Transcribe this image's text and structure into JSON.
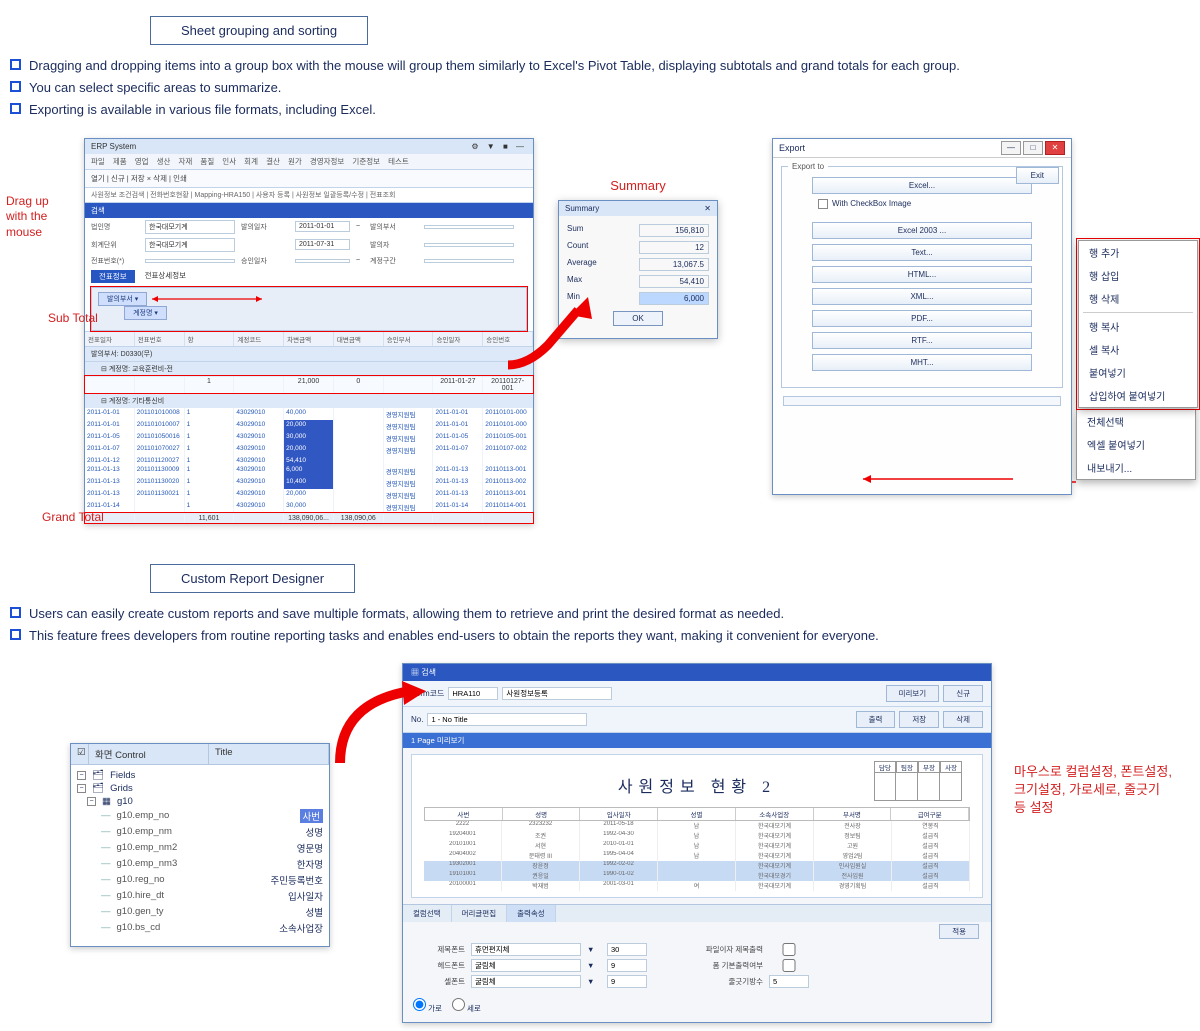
{
  "section1": {
    "title": "Sheet grouping and sorting",
    "bullets": [
      "Dragging and dropping items into a group box with the mouse will group them similarly to Excel's Pivot Table, displaying subtotals and grand totals for each group.",
      "You can select specific areas to summarize.",
      "Exporting is available in various file formats, including Excel."
    ],
    "annotations": {
      "drag": "Drag up\nwith the\nmouse",
      "subtotal": "Sub Total",
      "grandtotal": "Grand Total",
      "summary": "Summary"
    }
  },
  "erp": {
    "title": "ERP System",
    "menu": "파일 제품 영업 생산 자재 품질 인사 회계 결산 원가 경영자정보 기준정보 테스트",
    "toolbar": "열기 | 신규 | 저장 × 삭제 | 인쇄",
    "tabs": "사원정보 조건검색 | 전화번호현황 | Mapping-HRA150 | 사용자 등록 | 사원정보 일괄등록/수정 | 전표조회",
    "filters": {
      "r1l": "법인명",
      "r1v": "한국대모기계",
      "r1l2": "발의일자",
      "d1": "2011-01-01",
      "r1l3": "발의부서",
      "r2l": "회계단위",
      "r2v": "한국대모기계",
      "d2": "2011-07-31",
      "r2l3": "발의자",
      "r3l": "전표번호(*)",
      "r3l2": "승인일자",
      "r3l3": "계정구간"
    },
    "tab2l": "전표정보",
    "tab2r": "전표상세정보",
    "chip1": "발의부서 ▾",
    "chip2": "계정명 ▾",
    "gridHeaders": [
      "전표일자",
      "전표번호",
      "항",
      "계정코드",
      "차변금액",
      "대변금액",
      "승인부서",
      "승인일자",
      "승인번호"
    ],
    "group1": "발의부서: D0330(무)",
    "group2": "계정명: 교육훈련비-전",
    "subtotals": [
      "",
      "",
      "1",
      "",
      "21,000",
      "0",
      "",
      "",
      ""
    ],
    "group3": "계정명: 기타통신비",
    "rows": [
      [
        "2011-01-01",
        "201101010008",
        "1",
        "43029010",
        "40,000",
        "",
        "경영지원팀",
        "2011-01-01",
        "20110101-000"
      ],
      [
        "2011-01-01",
        "201101010007",
        "1",
        "43029010",
        "20,000",
        "",
        "경영지원팀",
        "2011-01-01",
        "20110101-000"
      ],
      [
        "2011-01-05",
        "201101050016",
        "1",
        "43029010",
        "30,000",
        "",
        "경영지원팀",
        "2011-01-05",
        "20110105-001"
      ],
      [
        "2011-01-07",
        "201101070027",
        "1",
        "43029010",
        "20,000",
        "",
        "경영지원팀",
        "2011-01-07",
        "20110107-002"
      ],
      [
        "2011-01-12",
        "201101120027",
        "1",
        "43029010",
        "54,410",
        "",
        "",
        "",
        ""
      ],
      [
        "2011-01-13",
        "201101130009",
        "1",
        "43029010",
        "6,000",
        "",
        "경영지원팀",
        "2011-01-13",
        "20110113-001"
      ],
      [
        "2011-01-13",
        "201101130020",
        "1",
        "43029010",
        "10,400",
        "",
        "경영지원팀",
        "2011-01-13",
        "20110113-002"
      ],
      [
        "2011-01-13",
        "201101130021",
        "1",
        "43029010",
        "20,000",
        "",
        "경영지원팀",
        "2011-01-13",
        "20110113-001"
      ],
      [
        "2011-01-14",
        "",
        "1",
        "43029010",
        "30,000",
        "",
        "경영지원팀",
        "2011-01-14",
        "20110114-001"
      ]
    ],
    "gt": [
      "",
      "",
      "11,601",
      "",
      "138,090,06...",
      "138,090,06",
      "",
      "",
      ""
    ],
    "extra_date": "2011-01-27",
    "extra_no": "20110127-001"
  },
  "summary": {
    "title": "Summary",
    "rows": [
      {
        "k": "Sum",
        "v": "156,810"
      },
      {
        "k": "Count",
        "v": "12"
      },
      {
        "k": "Average",
        "v": "13,067.5"
      },
      {
        "k": "Max",
        "v": "54,410"
      },
      {
        "k": "Min",
        "v": "6,000"
      }
    ],
    "ok": "OK"
  },
  "export": {
    "title": "Export",
    "group": "Export to",
    "exit": "Exit",
    "checkbox": "With CheckBox Image",
    "buttons": [
      "Excel...",
      "Excel 2003 ...",
      "Text...",
      "HTML...",
      "XML...",
      "PDF...",
      "RTF...",
      "MHT..."
    ]
  },
  "ctx": {
    "group1": [
      "행 추가",
      "행 삽입",
      "행 삭제"
    ],
    "group2": [
      "행 복사",
      "셀 복사",
      "붙여넣기",
      "삽입하여 붙여넣기"
    ],
    "group3": [
      "전체선택",
      "엑셀 붙여넣기",
      "내보내기..."
    ]
  },
  "section2": {
    "title": "Custom Report Designer",
    "bullets": [
      "Users can easily create custom reports and save multiple formats, allowing them to retrieve and print the desired format as needed.",
      "This feature frees developers from routine reporting tasks and enables end-users to obtain the reports they want, making it convenient for everyone."
    ]
  },
  "fields": {
    "col1": "화면 Control",
    "col2": "Title",
    "root1": "Fields",
    "root2": "Grids",
    "root3": "g10",
    "leaves": [
      {
        "key": "g10.emp_no",
        "label": "사번",
        "sel": true
      },
      {
        "key": "g10.emp_nm",
        "label": "성명"
      },
      {
        "key": "g10.emp_nm2",
        "label": "영문명"
      },
      {
        "key": "g10.emp_nm3",
        "label": "한자명"
      },
      {
        "key": "g10.reg_no",
        "label": "주민등록번호"
      },
      {
        "key": "g10.hire_dt",
        "label": "입사일자"
      },
      {
        "key": "g10.gen_ty",
        "label": "성별"
      },
      {
        "key": "g10.bs_cd",
        "label": "소속사업장"
      }
    ]
  },
  "designer": {
    "bar": "검색",
    "form_lbl": "Form코드",
    "form_code": "HRA110",
    "form_desc": "사원정보등록",
    "no_lbl": "No.",
    "no_val": "1 - No Title",
    "btns": {
      "preview": "미리보기",
      "print": "출력",
      "new": "신규",
      "save": "저장",
      "del": "삭제"
    },
    "page_tab": "1 Page 미리보기",
    "report_title": "사원정보 현황 2",
    "sig": [
      "담당",
      "팀장",
      "부장",
      "사장"
    ],
    "tbl_h": [
      "사번",
      "성명",
      "입사일자",
      "성별",
      "소속사업장",
      "부서명",
      "급여구분"
    ],
    "tbl_rows": [
      [
        "2222",
        "2323232",
        "2011-05-18",
        "남",
        "한국대모기계",
        "전사장",
        "연봉직"
      ],
      [
        "19204001",
        "조권",
        "1992-04-30",
        "남",
        "한국대모기계",
        "정보팀",
        "설급직"
      ],
      [
        "20101001",
        "서현",
        "2010-01-01",
        "남",
        "한국대모기계",
        "고원",
        "설급직"
      ],
      [
        "20404002",
        "문태령 III",
        "1995-04-04",
        "남",
        "한국대모기계",
        "영업2팀",
        "설급직"
      ],
      [
        "19302001",
        "장윤정",
        "1992-02-02",
        "",
        "한국대모기계",
        "인사임원실",
        "설급직"
      ],
      [
        "19101001",
        "권응일",
        "1990-01-02",
        "",
        "한국대모경기",
        "전사임원",
        "설급직"
      ],
      [
        "20100001",
        "박재범",
        "2001-03-01",
        "여",
        "한국대모기계",
        "경영기획팀",
        "설급직"
      ]
    ],
    "tabs": [
      "컬럼선택",
      "머리글편집",
      "출력속성"
    ],
    "apply": "적용",
    "props": {
      "l1": "제목폰트",
      "v1": "휴먼편지체",
      "n1": "30",
      "l1b": "파일이자 제목출력",
      "l2": "헤드폰트",
      "v2": "굴림체",
      "n2": "9",
      "l2b": "폼 기본출력여부",
      "l3": "셀폰트",
      "v3": "굴림체",
      "n3": "9",
      "l3b": "줄긋기방수",
      "n3b": "5",
      "radio1": "가로",
      "radio2": "세로"
    },
    "annotation": "마우스로 컬럼설정, 폰트설정, 크기설정,  가로세로, 줄긋기 등 설정"
  }
}
